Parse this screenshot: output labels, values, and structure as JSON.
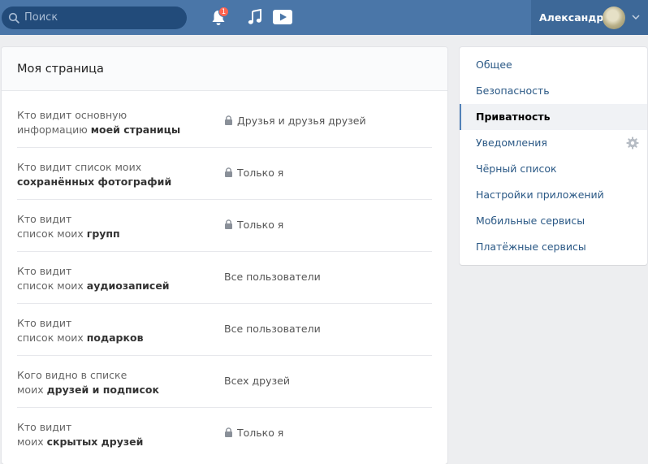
{
  "header": {
    "search_placeholder": "Поиск",
    "notification_count": "1",
    "user_name": "Александр"
  },
  "main": {
    "title": "Моя страница",
    "rows": [
      {
        "q1": "Кто видит основную",
        "q2a": "информацию ",
        "q2b": "моей страницы",
        "answer": "Друзья и друзья друзей",
        "locked": true
      },
      {
        "q1": "Кто видит список моих",
        "q2a": "",
        "q2b": "сохранённых фотографий",
        "answer": "Только я",
        "locked": true
      },
      {
        "q1": "Кто видит",
        "q2a": "список моих ",
        "q2b": "групп",
        "answer": "Только я",
        "locked": true
      },
      {
        "q1": "Кто видит",
        "q2a": "список моих ",
        "q2b": "аудиозаписей",
        "answer": "Все пользователи",
        "locked": false
      },
      {
        "q1": "Кто видит",
        "q2a": "список моих ",
        "q2b": "подарков",
        "answer": "Все пользователи",
        "locked": false
      },
      {
        "q1": "Кого видно в списке",
        "q2a": "моих ",
        "q2b": "друзей и подписок",
        "answer": "Всех друзей",
        "locked": false
      },
      {
        "q1": "Кто видит",
        "q2a": "моих ",
        "q2b": "скрытых друзей",
        "answer": "Только я",
        "locked": true
      }
    ]
  },
  "menu": {
    "items": [
      {
        "label": "Общее"
      },
      {
        "label": "Безопасность"
      },
      {
        "label": "Приватность"
      },
      {
        "label": "Уведомления"
      },
      {
        "label": "Чёрный список"
      },
      {
        "label": "Настройки приложений"
      },
      {
        "label": "Мобильные сервисы"
      },
      {
        "label": "Платёжные сервисы"
      }
    ],
    "active_index": 2
  },
  "icons": {
    "search": "search-icon",
    "bell": "bell-icon",
    "music": "music-note-icon",
    "video": "video-play-icon",
    "chevron": "chevron-down-icon",
    "lock": "lock-icon",
    "gear": "gear-icon"
  },
  "colors": {
    "header_bg": "#4a76a8",
    "accent": "#5181b8",
    "link": "#2a5885",
    "badge": "#ff6450"
  }
}
